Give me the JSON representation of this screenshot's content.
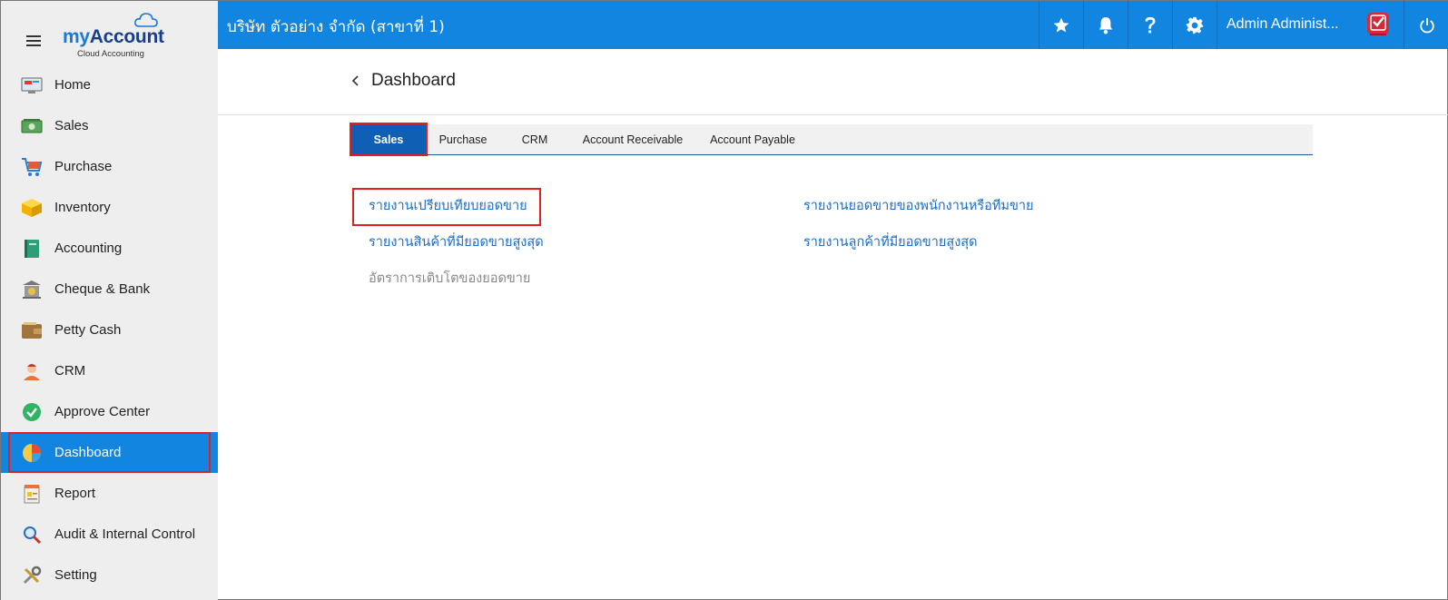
{
  "brand": {
    "logo_my": "my",
    "logo_account": "Account",
    "logo_sub": "Cloud Accounting"
  },
  "sidebar": {
    "items": [
      {
        "label": "Home",
        "icon": "home-monitor-icon"
      },
      {
        "label": "Sales",
        "icon": "money-bill-icon"
      },
      {
        "label": "Purchase",
        "icon": "shopping-cart-icon"
      },
      {
        "label": "Inventory",
        "icon": "box-icon"
      },
      {
        "label": "Accounting",
        "icon": "ledger-book-icon"
      },
      {
        "label": "Cheque & Bank",
        "icon": "bank-icon"
      },
      {
        "label": "Petty Cash",
        "icon": "wallet-icon"
      },
      {
        "label": "CRM",
        "icon": "people-icon"
      },
      {
        "label": "Approve Center",
        "icon": "check-circle-icon"
      },
      {
        "label": "Dashboard",
        "icon": "pie-chart-icon"
      },
      {
        "label": "Report",
        "icon": "report-icon"
      },
      {
        "label": "Audit & Internal Control",
        "icon": "magnifier-icon"
      },
      {
        "label": "Setting",
        "icon": "tools-icon"
      }
    ],
    "active": "Dashboard"
  },
  "topbar": {
    "company": "บริษัท ตัวอย่าง จำกัด (สาขาที่ 1)",
    "user_name": "Admin Administ...",
    "color": "#1285e0"
  },
  "page": {
    "title": "Dashboard"
  },
  "tabs": [
    {
      "label": "Sales",
      "active": true
    },
    {
      "label": "Purchase",
      "active": false
    },
    {
      "label": "CRM",
      "active": false
    },
    {
      "label": "Account Receivable",
      "active": false
    },
    {
      "label": "Account Payable",
      "active": false
    }
  ],
  "reports": {
    "left": [
      "รายงานเปรียบเทียบยอดขาย",
      "รายงานสินค้าที่มียอดขายสูงสุด",
      "อัตราการเติบโตของยอดขาย"
    ],
    "right": [
      "รายงานยอดขายของพนักงานหรือทีมขาย",
      "รายงานลูกค้าที่มียอดขายสูงสุด"
    ]
  }
}
